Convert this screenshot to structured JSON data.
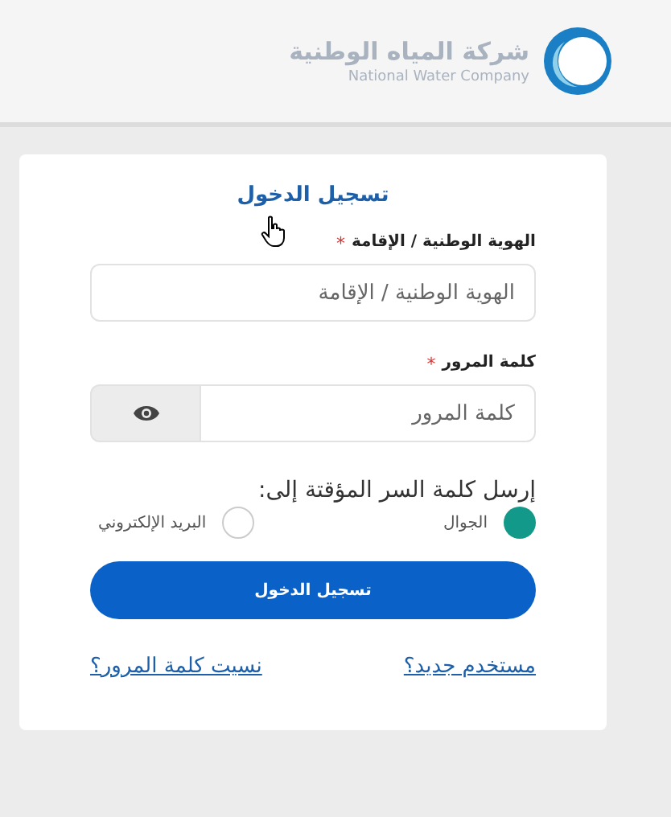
{
  "header": {
    "logo_name": "شركة المياه الوطنية",
    "logo_subtitle": "National Water Company"
  },
  "login": {
    "title": "تسجيل الدخول",
    "fields": [
      {
        "kind": "text",
        "label": "الهوية الوطنية / الإقامة",
        "required_mark": "*",
        "placeholder": "الهوية الوطنية / الإقامة"
      },
      {
        "kind": "password",
        "label": "كلمة المرور",
        "required_mark": "*",
        "placeholder": "كلمة المرور"
      }
    ],
    "otp_prompt": "إرسل كلمة السر المؤقتة إلى:",
    "otp_options": [
      {
        "label": "الجوال",
        "selected": true
      },
      {
        "label": "البريد الإلكتروني",
        "selected": false
      }
    ],
    "submit": "تسجيل الدخول",
    "links": [
      "مستخدم جديد؟",
      "نسيت كلمة المرور؟"
    ]
  }
}
